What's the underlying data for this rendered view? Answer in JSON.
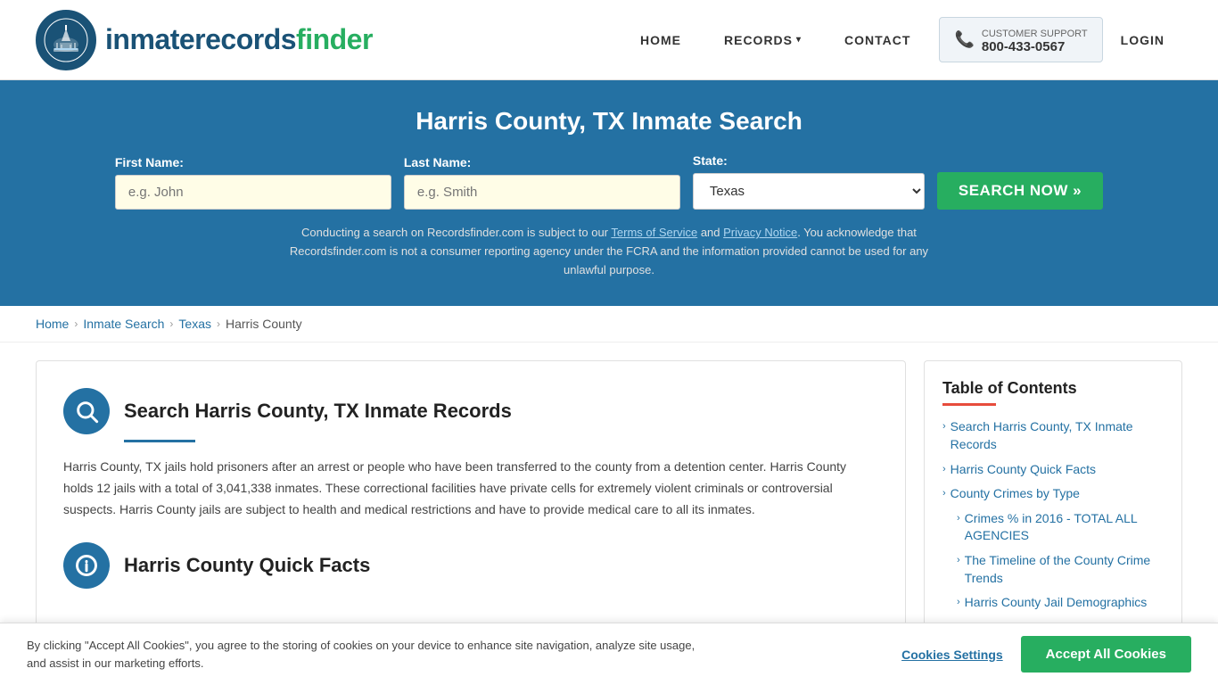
{
  "header": {
    "logo_text_inmate": "inmaterecords",
    "logo_text_finder": "finder",
    "nav": {
      "home": "HOME",
      "records": "RECORDS",
      "contact": "CONTACT",
      "customer_support_label": "CUSTOMER SUPPORT",
      "customer_support_number": "800-433-0567",
      "login": "LOGIN"
    }
  },
  "hero": {
    "title": "Harris County, TX Inmate Search",
    "form": {
      "first_name_label": "First Name:",
      "first_name_placeholder": "e.g. John",
      "last_name_label": "Last Name:",
      "last_name_placeholder": "e.g. Smith",
      "state_label": "State:",
      "state_value": "Texas",
      "search_button": "SEARCH NOW »"
    },
    "disclaimer": "Conducting a search on Recordsfinder.com is subject to our Terms of Service and Privacy Notice. You acknowledge that Recordsfinder.com is not a consumer reporting agency under the FCRA and the information provided cannot be used for any unlawful purpose."
  },
  "breadcrumb": {
    "home": "Home",
    "inmate_search": "Inmate Search",
    "texas": "Texas",
    "harris_county": "Harris County"
  },
  "main": {
    "section1": {
      "title": "Search Harris County, TX Inmate Records",
      "body": "Harris County, TX jails hold prisoners after an arrest or people who have been transferred to the county from a detention center. Harris County holds 12 jails with a total of 3,041,338 inmates. These correctional facilities have private cells for extremely violent criminals or controversial suspects. Harris County jails are subject to health and medical restrictions and have to provide medical care to all its inmates."
    },
    "section2": {
      "title": "Harris County Quick Facts"
    }
  },
  "sidebar": {
    "toc_title": "Table of Contents",
    "items": [
      {
        "label": "Search Harris County, TX Inmate Records",
        "sub": false
      },
      {
        "label": "Harris County Quick Facts",
        "sub": false
      },
      {
        "label": "County Crimes by Type",
        "sub": false
      },
      {
        "label": "Crimes % in 2016 - TOTAL ALL AGENCIES",
        "sub": true
      },
      {
        "label": "The Timeline of the County Crime Trends",
        "sub": true
      },
      {
        "label": "Harris County Jail Demographics",
        "sub": true
      }
    ]
  },
  "cookie_banner": {
    "text": "By clicking \"Accept All Cookies\", you agree to the storing of cookies on your device to enhance site navigation, analyze site usage, and assist in our marketing efforts.",
    "settings_btn": "Cookies Settings",
    "accept_btn": "Accept All Cookies"
  }
}
